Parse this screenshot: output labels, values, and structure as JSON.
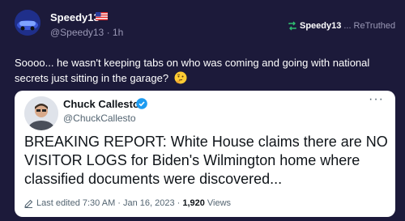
{
  "post": {
    "user_name": "Speedy13",
    "flag_icon": "us-flag-icon",
    "handle": "@Speedy13 · 1h",
    "retruth": {
      "icon": "retruth-icon",
      "user": "Speedy13",
      "ellipsis": "...",
      "label": "ReTruthed"
    },
    "text": "Soooo... he wasn't keeping tabs on who was coming and going with national secrets just sitting in the garage?",
    "emoji": "thinking-face-emoji"
  },
  "quote": {
    "name": "Chuck Callesto",
    "verified_icon": "verified-badge-icon",
    "handle": "@ChuckCallesto",
    "more": "···",
    "text": "BREAKING REPORT: White House claims there are NO VISITOR LOGS for Biden's Wilmington home where classified documents were discovered...",
    "edited": "Last edited 7:30 AM · Jan 16, 2023 ·",
    "views_count": "1,920",
    "views_label": "Views"
  },
  "colors": {
    "background": "#1c1a3a",
    "retruth_accent": "#2fbf71",
    "verified": "#1d9bf0"
  }
}
